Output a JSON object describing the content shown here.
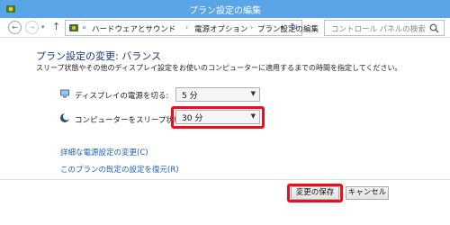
{
  "window": {
    "title": "プラン設定の編集"
  },
  "address_bar": {
    "chevron": "«",
    "crumbs": [
      "ハードウェアとサウンド",
      "電源オプション",
      "プラン設定の編集"
    ],
    "separator": "›",
    "search_placeholder": "コントロール パネルの検索"
  },
  "main": {
    "title": "プラン設定の変更: バランス",
    "description": "スリープ状態やその他のディスプレイ設定をお使いのコンピューターに適用するまでの時間を指定してください。",
    "settings": [
      {
        "label": "ディスプレイの電源を切る:",
        "value": "5 分",
        "icon": "monitor-icon"
      },
      {
        "label": "コンピューターをスリープ状態にする:",
        "value": "30 分",
        "icon": "sleep-moon-icon"
      }
    ],
    "links": {
      "advanced": "詳細な電源設定の変更(C)",
      "restore": "このプランの既定の設定を復元(R)"
    }
  },
  "buttons": {
    "save": "変更の保存",
    "cancel": "キャンセル"
  },
  "colors": {
    "titlebar": "#5aa5e6",
    "highlight": "#e8101a",
    "title_text": "#1e3287",
    "link": "#1c5fb0"
  }
}
